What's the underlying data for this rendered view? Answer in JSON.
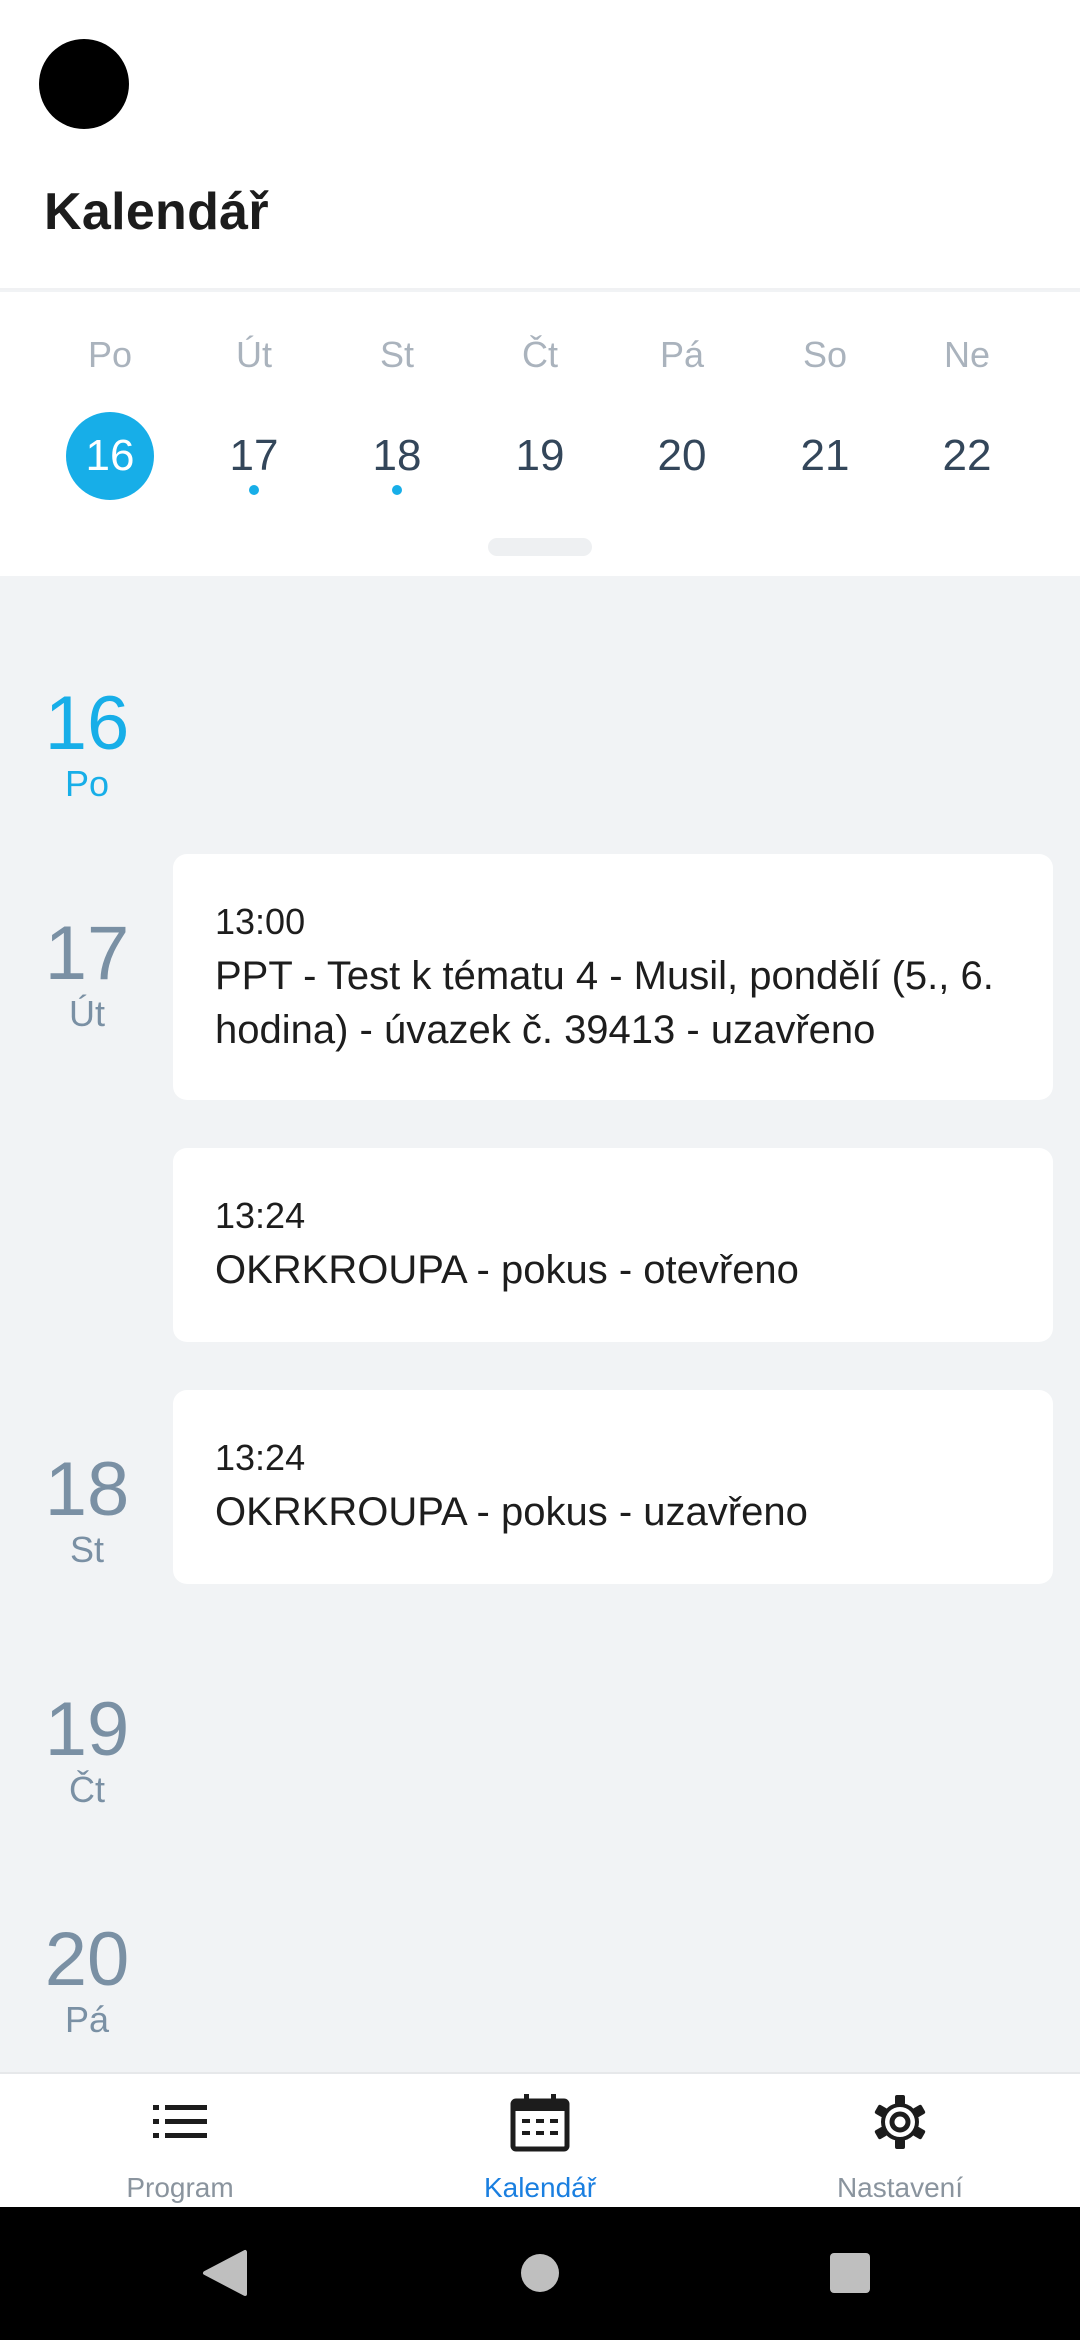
{
  "header": {
    "title": "Kalendář"
  },
  "week": {
    "days": [
      {
        "name": "Po",
        "date": "16",
        "selected": true,
        "has_events": false
      },
      {
        "name": "Út",
        "date": "17",
        "selected": false,
        "has_events": true
      },
      {
        "name": "St",
        "date": "18",
        "selected": false,
        "has_events": true
      },
      {
        "name": "Čt",
        "date": "19",
        "selected": false,
        "has_events": false
      },
      {
        "name": "Pá",
        "date": "20",
        "selected": false,
        "has_events": false
      },
      {
        "name": "So",
        "date": "21",
        "selected": false,
        "has_events": false
      },
      {
        "name": "Ne",
        "date": "22",
        "selected": false,
        "has_events": false
      }
    ]
  },
  "agenda": {
    "days": [
      {
        "num": "16",
        "name": "Po"
      },
      {
        "num": "17",
        "name": "Út"
      },
      {
        "num": "18",
        "name": "St"
      },
      {
        "num": "19",
        "name": "Čt"
      },
      {
        "num": "20",
        "name": "Pá"
      }
    ],
    "events": [
      {
        "time": "13:00",
        "title": "PPT - Test k tématu 4 - Musil, pondělí (5., 6. hodina) - úvazek č. 39413 - uzavřeno"
      },
      {
        "time": "13:24",
        "title": "OKRKROUPA - pokus - otevřeno"
      },
      {
        "time": "13:24",
        "title": "OKRKROUPA - pokus - uzavřeno"
      }
    ]
  },
  "bottom_nav": {
    "items": [
      {
        "label": "Program",
        "icon": "list-icon",
        "active": false
      },
      {
        "label": "Kalendář",
        "icon": "calendar-icon",
        "active": true
      },
      {
        "label": "Nastavení",
        "icon": "gear-icon",
        "active": false
      }
    ]
  },
  "colors": {
    "accent": "#17aee8",
    "active_nav": "#1a7fe0",
    "muted_day": "#7a90a4"
  },
  "system_nav": {
    "icons": [
      "back-icon",
      "home-icon",
      "recents-icon"
    ]
  }
}
